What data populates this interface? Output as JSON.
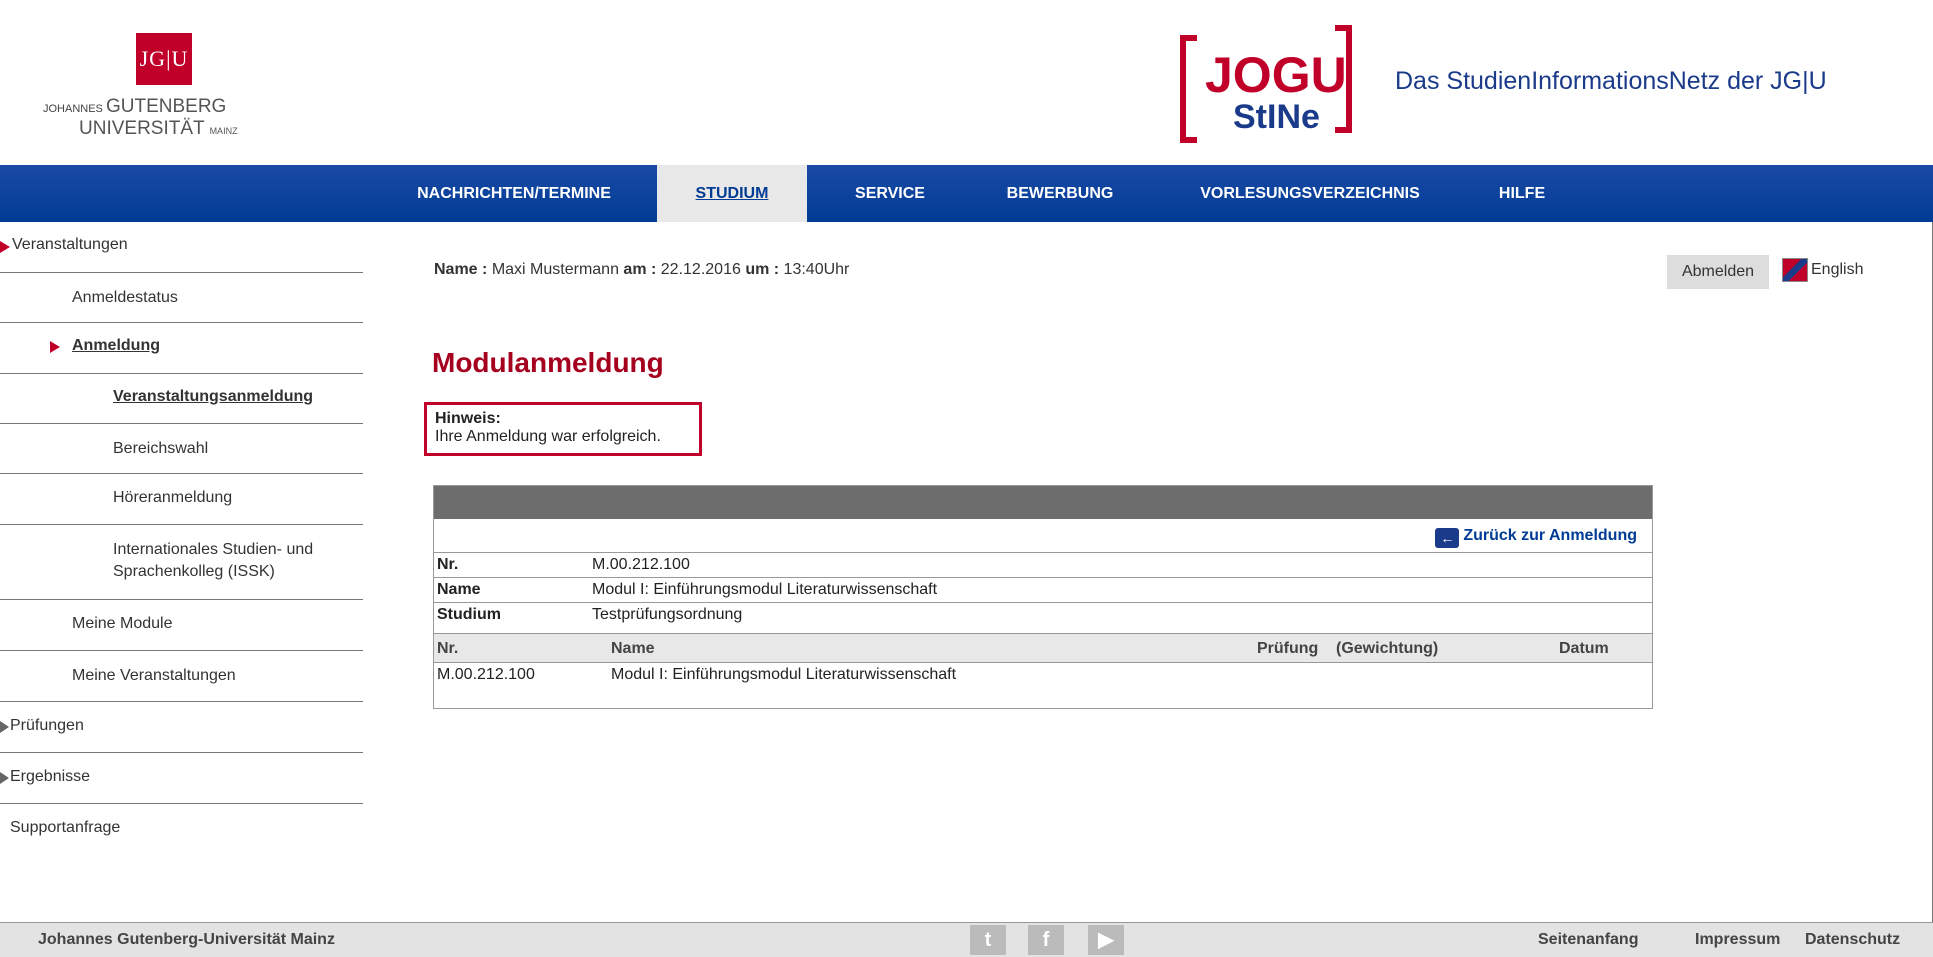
{
  "header": {
    "jgu_logo": "JG|U",
    "jgu_line1_small": "JOHANNES",
    "jgu_line1_big": "GUTENBERG",
    "jgu_line2": "UNIVERSITÄT",
    "jgu_line2_small": "MAINZ",
    "jogustine_top": "JOGU",
    "jogustine_mid": "StINe",
    "site_title": "Das StudienInformationsNetz der JG|U"
  },
  "nav": {
    "items": [
      {
        "label": "NACHRICHTEN/TERMINE"
      },
      {
        "label": "STUDIUM"
      },
      {
        "label": "SERVICE"
      },
      {
        "label": "BEWERBUNG"
      },
      {
        "label": "VORLESUNGSVERZEICHNIS"
      },
      {
        "label": "HILFE"
      }
    ]
  },
  "sidebar": {
    "items": [
      {
        "label": "Veranstaltungen"
      },
      {
        "label": "Anmeldestatus"
      },
      {
        "label": "Anmeldung"
      },
      {
        "label": "Veranstaltungsanmeldung"
      },
      {
        "label": "Bereichswahl"
      },
      {
        "label": "Höreranmeldung"
      },
      {
        "label": "Internationales Studien- und"
      },
      {
        "label": "Sprachenkolleg (ISSK)"
      },
      {
        "label": "Meine Module"
      },
      {
        "label": "Meine Veranstaltungen"
      },
      {
        "label": "Prüfungen"
      },
      {
        "label": "Ergebnisse"
      },
      {
        "label": "Supportanfrage"
      }
    ]
  },
  "session": {
    "name_label": "Name :",
    "name_value": "Maxi Mustermann",
    "date_label": "am :",
    "date_value": "22.12.2016",
    "time_label": "um :",
    "time_value": "13:40Uhr",
    "logout": "Abmelden",
    "language": "English"
  },
  "main": {
    "title": "Modulanmeldung",
    "hint_title": "Hinweis:",
    "hint_text": "Ihre Anmeldung war erfolgreich.",
    "back_link": "Zurück zur Anmeldung"
  },
  "details": [
    {
      "label": "Nr.",
      "value": "M.00.212.100"
    },
    {
      "label": "Name",
      "value": "Modul I: Einführungsmodul Literaturwissenschaft"
    },
    {
      "label": "Studium",
      "value": "Testprüfungsordnung"
    }
  ],
  "table": {
    "headers": {
      "nr": "Nr.",
      "name": "Name",
      "pruefung": "Prüfung",
      "gewichtung": "(Gewichtung)",
      "datum": "Datum"
    },
    "rows": [
      {
        "nr": "M.00.212.100",
        "name": "Modul I: Einführungsmodul Literaturwissenschaft"
      }
    ]
  },
  "footer": {
    "university": "Johannes Gutenberg-Universität Mainz",
    "social": [
      "twitter-icon",
      "facebook-icon",
      "youtube-icon"
    ],
    "top": "Seitenanfang",
    "impressum": "Impressum",
    "datenschutz": "Datenschutz"
  }
}
